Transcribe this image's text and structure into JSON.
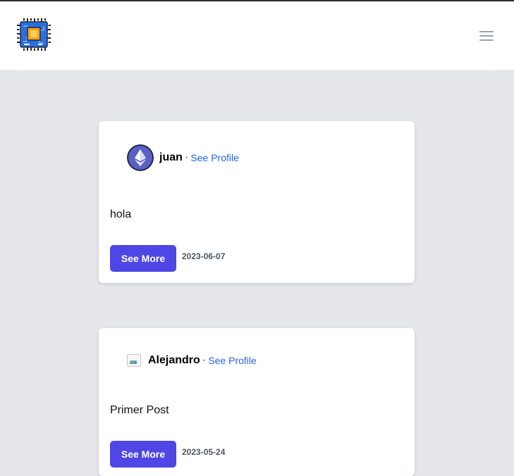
{
  "header": {
    "logo_icon": "circuit-chip-logo",
    "menu_icon": "hamburger-menu-icon"
  },
  "posts": [
    {
      "author": "juan",
      "avatar_icon": "ethereum-icon",
      "profile_link": "See Profile",
      "content": "hola",
      "button": "See More",
      "date": "2023-06-07"
    },
    {
      "author": "Alejandro",
      "avatar_icon": "broken-image-icon",
      "profile_link": "See Profile",
      "content": "Primer Post",
      "button": "See More",
      "date": "2023-05-24"
    }
  ],
  "colors": {
    "accent": "#4f46e5",
    "link": "#2563eb",
    "background": "#e5e7eb",
    "avatar": "#5b61c4"
  }
}
